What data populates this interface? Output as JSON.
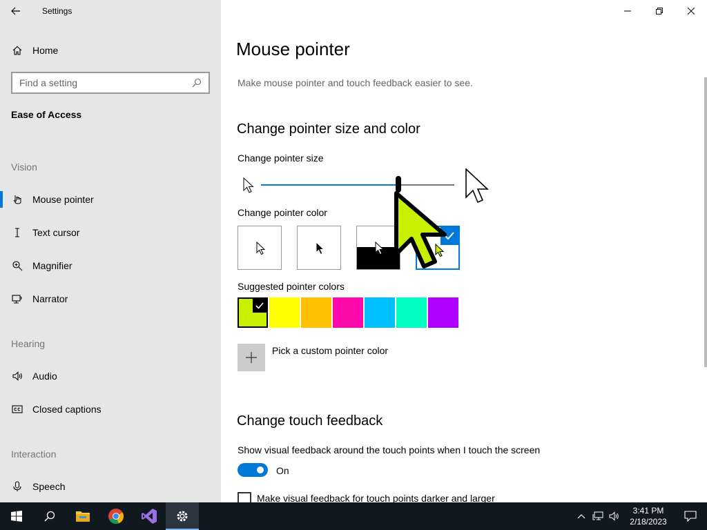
{
  "window": {
    "title": "Settings"
  },
  "sidebar": {
    "home_label": "Home",
    "search_placeholder": "Find a setting",
    "current_section": "Ease of Access",
    "groups": {
      "vision": "Vision",
      "hearing": "Hearing",
      "interaction": "Interaction"
    },
    "items": [
      {
        "label": "Mouse pointer",
        "icon": "mouse-pointer-icon",
        "active": true
      },
      {
        "label": "Text cursor",
        "icon": "text-cursor-icon",
        "active": false
      },
      {
        "label": "Magnifier",
        "icon": "magnifier-icon",
        "active": false
      },
      {
        "label": "Narrator",
        "icon": "narrator-icon",
        "active": false
      },
      {
        "label": "Audio",
        "icon": "audio-icon",
        "active": false
      },
      {
        "label": "Closed captions",
        "icon": "closed-captions-icon",
        "active": false
      },
      {
        "label": "Speech",
        "icon": "speech-icon",
        "active": false
      }
    ]
  },
  "main": {
    "page_title": "Mouse pointer",
    "page_description": "Make mouse pointer and touch feedback easier to see.",
    "section_pointer": "Change pointer size and color",
    "pointer_size_label": "Change pointer size",
    "pointer_size_value": 0.71,
    "pointer_color_label": "Change pointer color",
    "pointer_color_options": [
      "white",
      "black",
      "inverted",
      "custom"
    ],
    "pointer_color_selected": "custom",
    "suggested_colors_label": "Suggested pointer colors",
    "suggested_colors": [
      "#c8f000",
      "#ffff00",
      "#ffc000",
      "#ff0aaa",
      "#00bfff",
      "#00ffc0",
      "#b000ff"
    ],
    "suggested_selected_index": 0,
    "custom_color_label": "Pick a custom pointer color",
    "section_touch": "Change touch feedback",
    "touch_feedback_label": "Show visual feedback around the touch points when I touch the screen",
    "touch_toggle_state": "On",
    "darker_label": "Make visual feedback for touch points darker and larger"
  },
  "taskbar": {
    "apps": [
      "start-icon",
      "search-icon",
      "file-explorer-icon",
      "chrome-icon",
      "visual-studio-icon",
      "settings-icon"
    ],
    "time": "3:41 PM",
    "date": "2/18/2023"
  },
  "colors": {
    "accent": "#0078d7",
    "pointer_custom": "#c8f000"
  }
}
